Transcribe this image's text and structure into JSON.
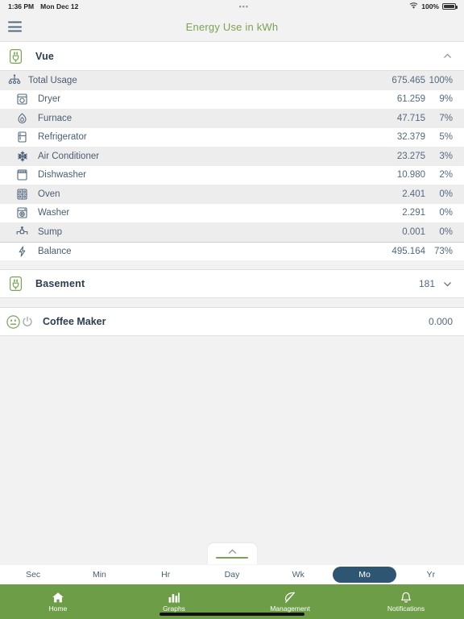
{
  "status_bar": {
    "time": "1:36 PM",
    "date": "Mon Dec 12",
    "center": "•••",
    "battery_pct": "100%",
    "wifi_icon": "wifi-icon"
  },
  "nav": {
    "menu_icon": "hamburger-menu-icon",
    "title": "Energy Use in kWh",
    "title_color": "#7aa352"
  },
  "devices": [
    {
      "name": "Vue",
      "icon": "vue-plug-icon",
      "value": "",
      "expanded": true,
      "chevron": "chevron-up-icon"
    }
  ],
  "circuits": [
    {
      "label": "Total Usage",
      "value": "675.465",
      "pct": "100%",
      "icon": "circuit-tree-icon"
    },
    {
      "label": "Dryer",
      "value": "61.259",
      "pct": "9%",
      "icon": "dryer-icon"
    },
    {
      "label": "Furnace",
      "value": "47.715",
      "pct": "7%",
      "icon": "flame-icon"
    },
    {
      "label": "Refrigerator",
      "value": "32.379",
      "pct": "5%",
      "icon": "refrigerator-icon"
    },
    {
      "label": "Air Conditioner",
      "value": "23.275",
      "pct": "3%",
      "icon": "snowflake-icon"
    },
    {
      "label": "Dishwasher",
      "value": "10.980",
      "pct": "2%",
      "icon": "dishwasher-icon"
    },
    {
      "label": "Oven",
      "value": "2.401",
      "pct": "0%",
      "icon": "oven-icon"
    },
    {
      "label": "Washer",
      "value": "2.291",
      "pct": "0%",
      "icon": "washer-icon"
    },
    {
      "label": "Sump",
      "value": "0.001",
      "pct": "0%",
      "icon": "sump-pump-icon"
    },
    {
      "label": "Balance",
      "value": "495.164",
      "pct": "73%",
      "icon": "lightning-bolt-icon"
    }
  ],
  "basement": {
    "name": "Basement",
    "icon": "vue-plug-icon",
    "value": "181",
    "chevron": "chevron-down-icon"
  },
  "coffee_maker": {
    "name": "Coffee Maker",
    "outlet_icon": "smart-outlet-icon",
    "power_icon": "power-toggle-icon",
    "value": "0.000"
  },
  "pull_tab": {
    "icon": "chevron-up-icon",
    "accent_color": "#7aa352"
  },
  "periods": {
    "items": [
      "Sec",
      "Min",
      "Hr",
      "Day",
      "Wk",
      "Mo",
      "Yr"
    ],
    "selected": "Mo",
    "selected_color": "#2e5672"
  },
  "tabbar": {
    "background": "#6d9e47",
    "items": [
      {
        "label": "Home",
        "icon": "home-icon"
      },
      {
        "label": "Graphs",
        "icon": "bar-chart-icon"
      },
      {
        "label": "Management",
        "icon": "leaf-icon"
      },
      {
        "label": "Notifications",
        "icon": "bell-icon"
      }
    ]
  }
}
